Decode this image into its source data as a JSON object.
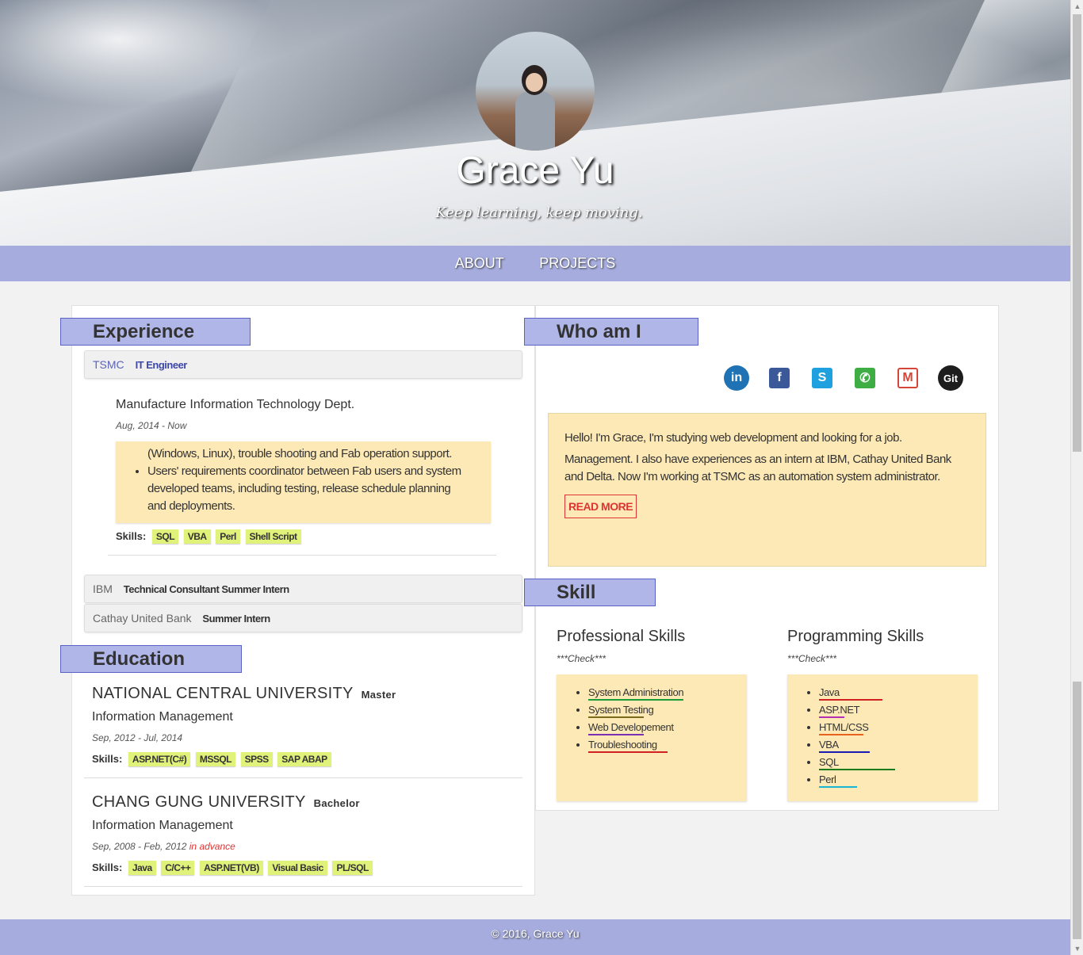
{
  "header": {
    "name": "Grace Yu",
    "tagline": "Keep learning, keep moving."
  },
  "nav": {
    "items": [
      "ABOUT",
      "PROJECTS"
    ]
  },
  "experience": {
    "heading": "Experience",
    "jobs": [
      {
        "company": "TSMC",
        "title": "IT Engineer"
      },
      {
        "company": "IBM",
        "title": "Technical Consultant Summer Intern"
      },
      {
        "company": "Cathay United Bank",
        "title": "Summer Intern"
      }
    ],
    "active": {
      "dept": "Manufacture Information Technology Dept.",
      "date": "Aug, 2014 - Now",
      "duty_cut": "(Windows, Linux), trouble shooting and Fab operation support.",
      "duty": "Users' requirements coordinator between Fab users and system developed teams, including testing, release schedule planning and deployments.",
      "skills_label": "Skills:",
      "skills": [
        "SQL",
        "VBA",
        "Perl",
        "Shell Script"
      ]
    }
  },
  "education": {
    "heading": "Education",
    "schools": [
      {
        "name": "NATIONAL CENTRAL UNIVERSITY",
        "degree": "Master",
        "major": "Information Management",
        "date": "Sep, 2012 - Jul, 2014",
        "note": "",
        "skills_label": "Skills:",
        "skills": [
          "ASP.NET(C#)",
          "MSSQL",
          "SPSS",
          "SAP ABAP"
        ]
      },
      {
        "name": "CHANG GUNG UNIVERSITY",
        "degree": "Bachelor",
        "major": "Information Management",
        "date": "Sep, 2008 - Feb, 2012",
        "note": "in advance",
        "skills_label": "Skills:",
        "skills": [
          "Java",
          "C/C++",
          "ASP.NET(VB)",
          "Visual Basic",
          "PL/SQL"
        ]
      }
    ]
  },
  "who": {
    "heading": "Who am I",
    "social": [
      {
        "name": "linkedin",
        "glyph": "in",
        "color": "#1f73b5"
      },
      {
        "name": "facebook",
        "glyph": "f",
        "color": "#3b5998"
      },
      {
        "name": "skype",
        "glyph": "S",
        "color": "#1ea1de"
      },
      {
        "name": "whatsapp",
        "glyph": "✆",
        "color": "#3ead44"
      },
      {
        "name": "gmail",
        "glyph": "M",
        "color": "#d44638"
      },
      {
        "name": "git",
        "glyph": "Git",
        "color": "#1d1d1d"
      }
    ],
    "about_line1": "Hello! I'm Grace, I'm studying web development and looking for a job.",
    "about_line2": "Management. I also have experiences as an intern at IBM, Cathay United Bank and Delta. Now I'm working at TSMC as an automation system administrator.",
    "read_more": "READ MORE"
  },
  "skill": {
    "heading": "Skill",
    "professional": {
      "title": "Professional Skills",
      "check": "***Check***",
      "items": [
        {
          "name": "System Administration",
          "level": 0.6,
          "color": "#1a9c3a"
        },
        {
          "name": "System Testing",
          "level": 0.35,
          "color": "#7a6b1a"
        },
        {
          "name": "Web Developement",
          "level": 0.35,
          "color": "#7b2fb5"
        },
        {
          "name": "Troubleshooting",
          "level": 0.5,
          "color": "#d32020"
        }
      ]
    },
    "programming": {
      "title": "Programming Skills",
      "check": "***Check***",
      "items": [
        {
          "name": "Java",
          "level": 0.4,
          "color": "#d32020"
        },
        {
          "name": "ASP.NET",
          "level": 0.16,
          "color": "#b52fb5"
        },
        {
          "name": "HTML/CSS",
          "level": 0.28,
          "color": "#e8641e"
        },
        {
          "name": "VBA",
          "level": 0.32,
          "color": "#1a1ab5"
        },
        {
          "name": "SQL",
          "level": 0.48,
          "color": "#1a7a1a"
        },
        {
          "name": "Perl",
          "level": 0.24,
          "color": "#1ab5d3"
        }
      ]
    }
  },
  "footer": {
    "text": "© 2016, Grace Yu"
  }
}
